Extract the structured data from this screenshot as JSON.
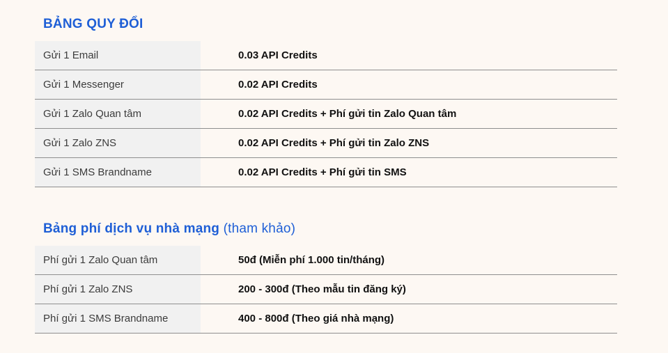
{
  "conversion_table": {
    "title": "BẢNG QUY ĐỔI",
    "rows": [
      {
        "label": "Gửi 1 Email",
        "value": "0.03 API Credits"
      },
      {
        "label": "Gửi 1 Messenger",
        "value": "0.02 API Credits"
      },
      {
        "label": "Gửi 1 Zalo Quan tâm",
        "value": "0.02 API Credits + Phí gửi tin Zalo Quan tâm"
      },
      {
        "label": "Gửi 1 Zalo ZNS",
        "value": "0.02 API Credits + Phí gửi tin Zalo ZNS"
      },
      {
        "label": "Gửi 1 SMS Brandname",
        "value": "0.02 API Credits + Phí gửi tin SMS"
      }
    ]
  },
  "carrier_fee_table": {
    "title": "Bảng phí dịch vụ nhà mạng",
    "title_note": "(tham khảo)",
    "rows": [
      {
        "label": "Phí gửi 1 Zalo Quan tâm",
        "value": "50đ (Miễn phí 1.000 tin/tháng)"
      },
      {
        "label": "Phí gửi 1 Zalo ZNS",
        "value": "200 - 300đ (Theo mẫu tin đăng ký)"
      },
      {
        "label": "Phí gửi 1 SMS Brandname",
        "value": "400 - 800đ (Theo giá nhà mạng)"
      }
    ]
  },
  "colors": {
    "background": "#fdf8f3",
    "heading_blue": "#1f5fd6",
    "label_cell_bg": "#f1f1f1",
    "row_divider": "#8e8e8e"
  }
}
